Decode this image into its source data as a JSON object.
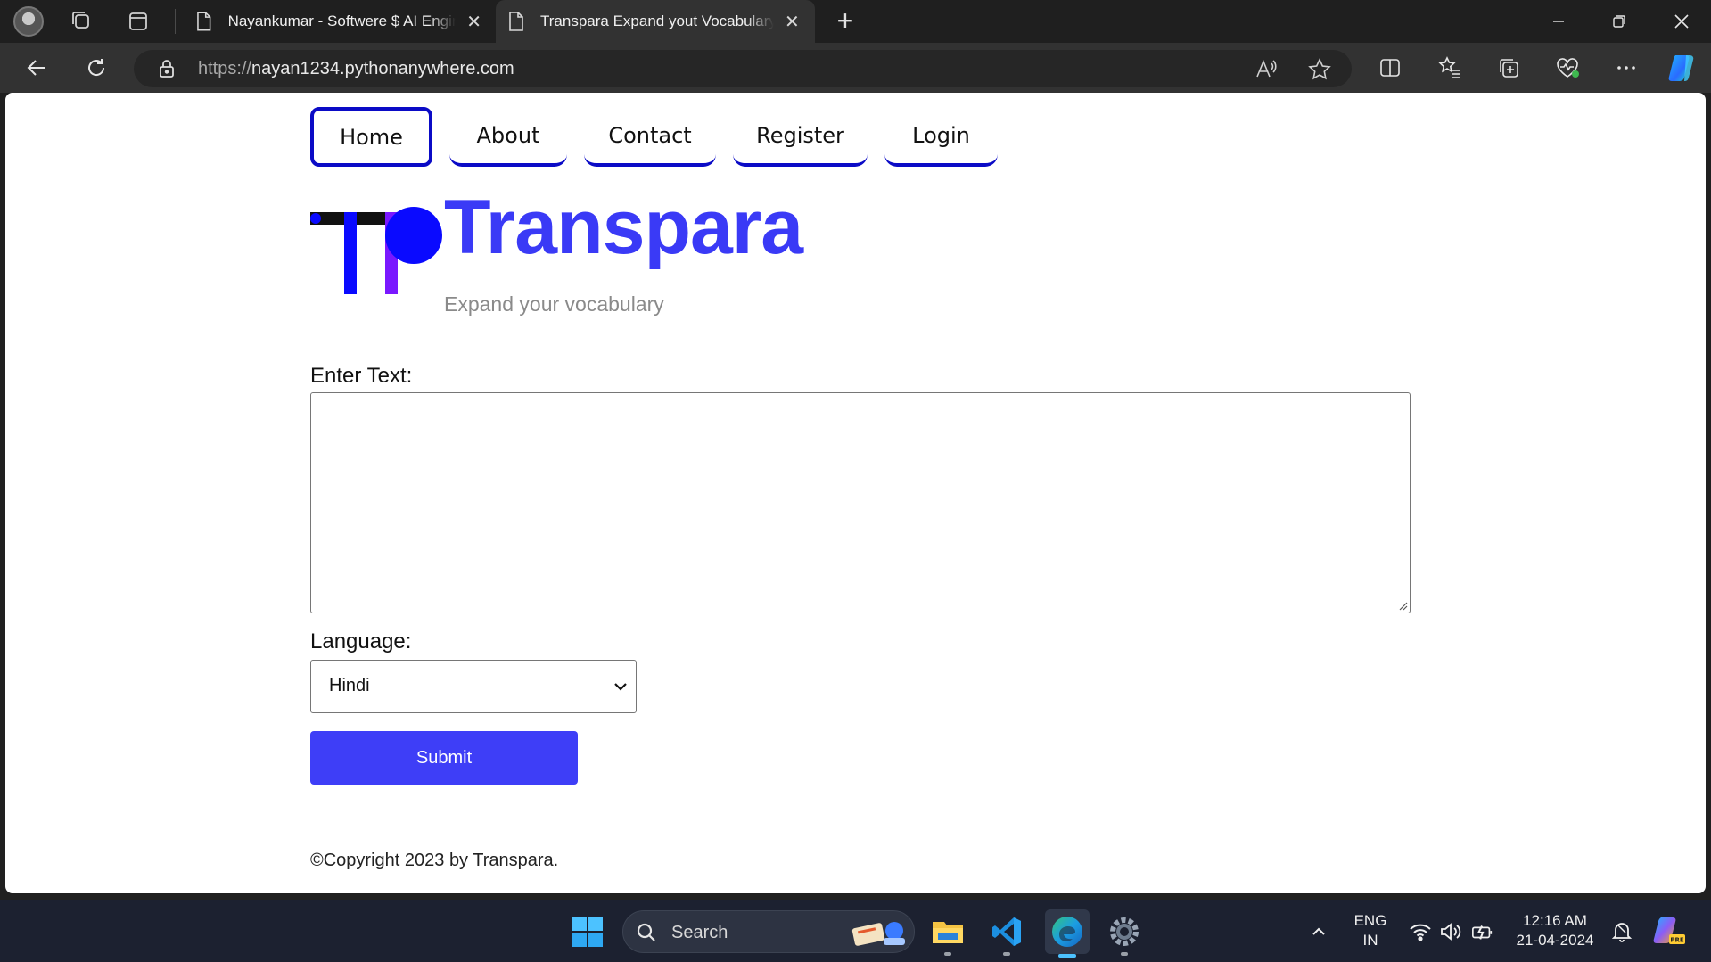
{
  "browser": {
    "tabs": [
      {
        "title": "Nayankumar - Softwere $ AI Engineer",
        "active": false
      },
      {
        "title": "Transpara Expand yout Vocabulary",
        "active": true
      }
    ],
    "address": {
      "scheme": "https://",
      "host": "nayan1234.pythonanywhere.com"
    }
  },
  "site": {
    "nav": [
      "Home",
      "About",
      "Contact",
      "Register",
      "Login"
    ],
    "active_nav": "Home",
    "brand_name": "Transpara",
    "tagline": "Expand your vocabulary",
    "form": {
      "text_label": "Enter Text:",
      "text_value": "",
      "language_label": "Language:",
      "language_selected": "Hindi",
      "submit_label": "Submit"
    },
    "footer": "©Copyright 2023 by Transpara.",
    "colors": {
      "brand": "#3a3af6",
      "nav_border": "#0b0bc6",
      "button": "#3e3ef7"
    }
  },
  "taskbar": {
    "search_placeholder": "Search",
    "language": {
      "line1": "ENG",
      "line2": "IN"
    },
    "clock": {
      "time": "12:16 AM",
      "date": "21-04-2024"
    }
  }
}
